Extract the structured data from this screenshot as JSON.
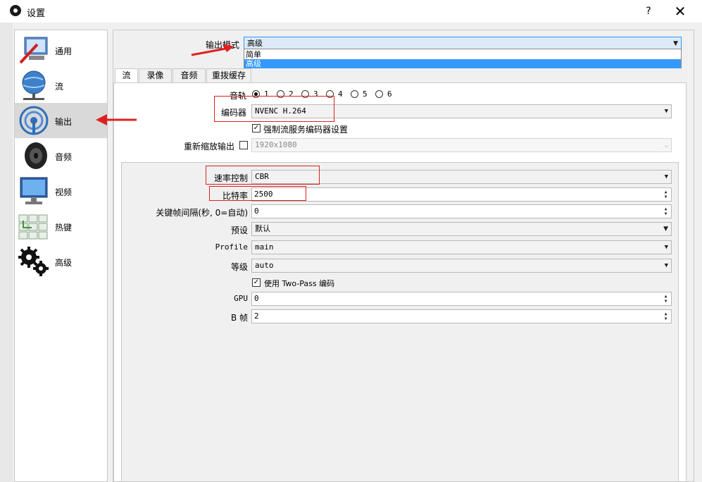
{
  "window": {
    "title": "设置",
    "help": "?",
    "close": "✕"
  },
  "sidebar": {
    "items": [
      {
        "label": "通用",
        "icon": "general-icon"
      },
      {
        "label": "流",
        "icon": "stream-icon"
      },
      {
        "label": "输出",
        "icon": "output-icon"
      },
      {
        "label": "音频",
        "icon": "audio-icon"
      },
      {
        "label": "视频",
        "icon": "video-icon"
      },
      {
        "label": "热键",
        "icon": "hotkeys-icon"
      },
      {
        "label": "高级",
        "icon": "advanced-icon"
      }
    ],
    "selected": "输出"
  },
  "output_mode": {
    "label": "输出模式",
    "value": "高级",
    "options": [
      "简单",
      "高级"
    ]
  },
  "tabs": [
    "流",
    "录像",
    "音频",
    "重拨缓存"
  ],
  "stream": {
    "audio_track_label": "音轨",
    "tracks": [
      "1",
      "2",
      "3",
      "4",
      "5",
      "6"
    ],
    "encoder_label": "编码器",
    "encoder_value": "NVENC H.264",
    "enforce_label": "强制流服务编码器设置",
    "rescale_label": "重新缩放输出",
    "rescale_value": "1920x1080"
  },
  "encoder_settings": {
    "rate_control_label": "速率控制",
    "rate_control_value": "CBR",
    "bitrate_label": "比特率",
    "bitrate_value": "2500",
    "keyframe_label": "关键帧间隔(秒, 0=自动)",
    "keyframe_value": "0",
    "preset_label": "预设",
    "preset_value": "默认",
    "profile_label": "Profile",
    "profile_value": "main",
    "level_label": "等级",
    "level_value": "auto",
    "twopass_label": "使用 Two-Pass 编码",
    "gpu_label": "GPU",
    "gpu_value": "0",
    "bframes_label": "B 帧",
    "bframes_value": "2"
  },
  "colors": {
    "annotation_red": "#e02020",
    "selection_blue": "#3399ff"
  }
}
